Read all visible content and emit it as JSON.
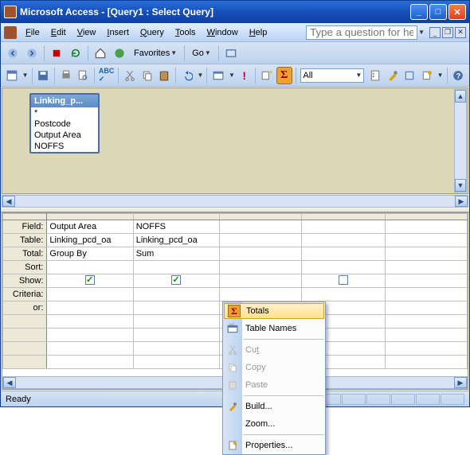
{
  "titlebar": {
    "title": "Microsoft Access - [Query1 : Select Query]"
  },
  "menu": {
    "file": "File",
    "edit": "Edit",
    "view": "View",
    "insert": "Insert",
    "query": "Query",
    "tools": "Tools",
    "window": "Window",
    "help": "Help"
  },
  "helpbox": {
    "placeholder": "Type a question for help"
  },
  "toolbar1": {
    "favorites": "Favorites",
    "go": "Go"
  },
  "toolbar2": {
    "querytype_combo": "All"
  },
  "diagram": {
    "table": {
      "title": "Linking_p...",
      "fields": [
        "*",
        "Postcode",
        "Output Area",
        "NOFFS"
      ]
    }
  },
  "grid": {
    "rows": [
      "Field:",
      "Table:",
      "Total:",
      "Sort:",
      "Show:",
      "Criteria:",
      "or:"
    ],
    "cols": [
      {
        "field": "Output Area",
        "table": "Linking_pcd_oa",
        "total": "Group By",
        "sort": "",
        "show": true,
        "criteria": "",
        "or": ""
      },
      {
        "field": "NOFFS",
        "table": "Linking_pcd_oa",
        "total": "Sum",
        "sort": "",
        "show": true,
        "criteria": "",
        "or": ""
      },
      {
        "field": "",
        "table": "",
        "total": "",
        "sort": "",
        "show": false,
        "criteria": "",
        "or": ""
      },
      {
        "field": "",
        "table": "",
        "total": "",
        "sort": "",
        "show": false,
        "criteria": "",
        "or": ""
      }
    ]
  },
  "context_menu": {
    "items": [
      {
        "label": "Totals",
        "icon": "sigma",
        "enabled": true,
        "hover": true
      },
      {
        "label": "Table Names",
        "icon": "tablename",
        "enabled": true
      },
      {
        "sep": true
      },
      {
        "label": "Cut",
        "icon": "cut",
        "enabled": false
      },
      {
        "label": "Copy",
        "icon": "copy",
        "enabled": false
      },
      {
        "label": "Paste",
        "icon": "paste",
        "enabled": false
      },
      {
        "sep": true
      },
      {
        "label": "Build...",
        "icon": "build",
        "enabled": true
      },
      {
        "label": "Zoom...",
        "icon": "",
        "enabled": true
      },
      {
        "sep": true
      },
      {
        "label": "Properties...",
        "icon": "props",
        "enabled": true
      }
    ]
  },
  "status": {
    "text": "Ready"
  }
}
